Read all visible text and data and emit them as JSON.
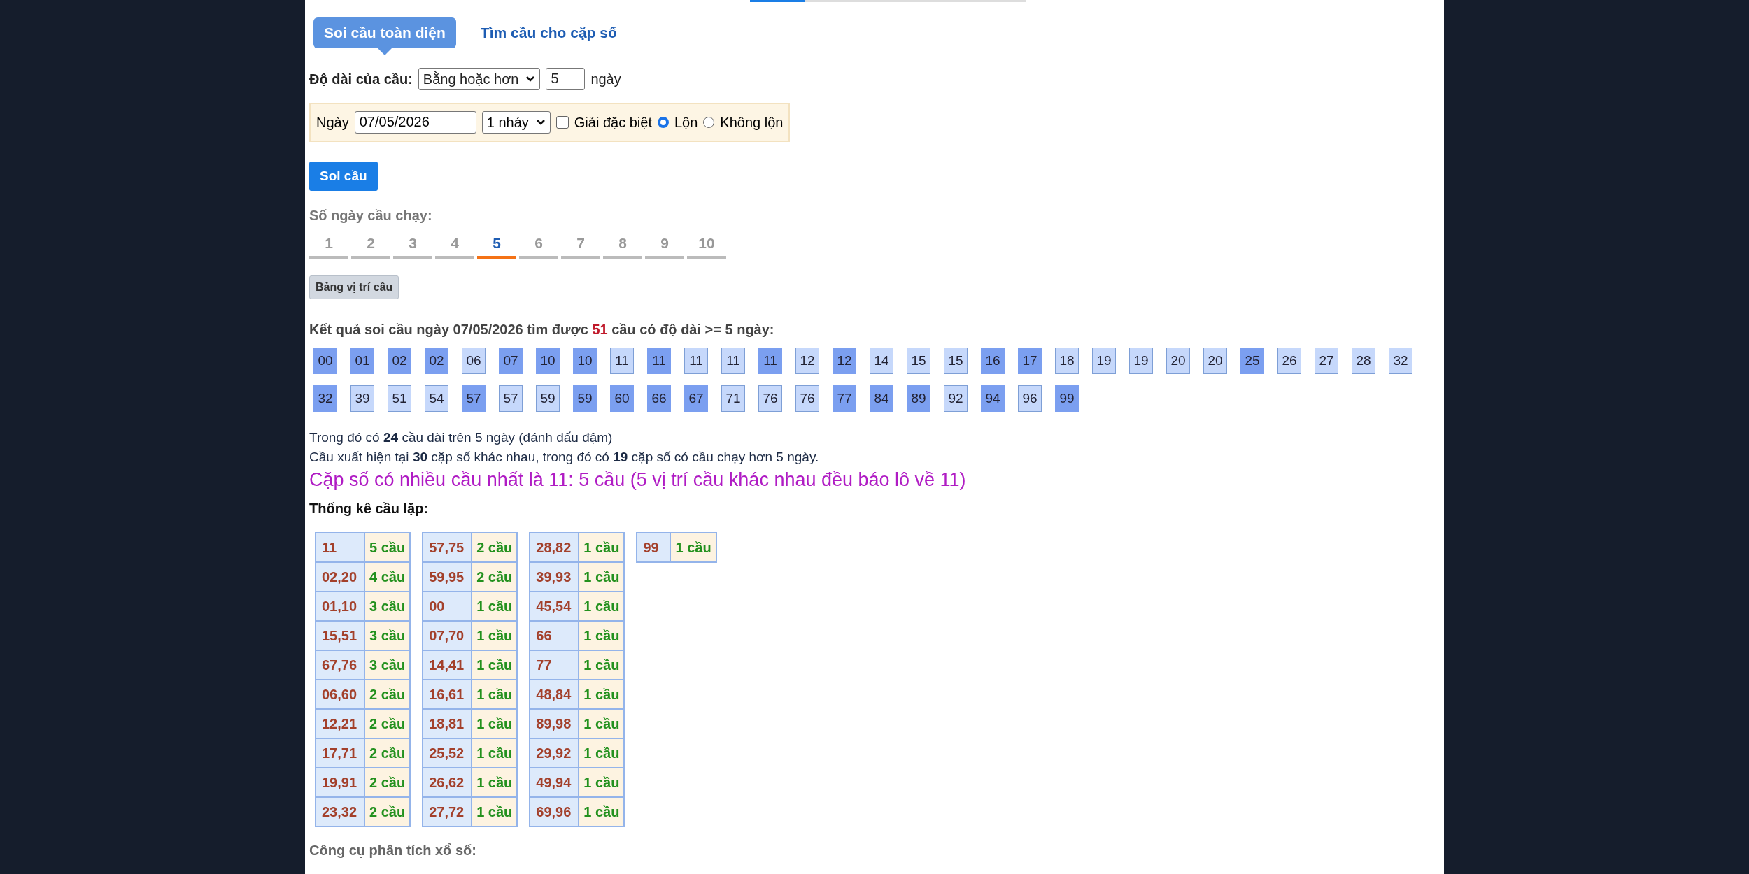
{
  "tabs": [
    {
      "label": "Soi cầu toàn diện",
      "selected": true
    },
    {
      "label": "Tìm cầu cho cặp số",
      "selected": false
    }
  ],
  "length_filter": {
    "label": "Độ dài của cầu:",
    "mode": "Bằng hoặc hơn",
    "value": "5",
    "unit": "ngày"
  },
  "options": {
    "date_label": "Ngày",
    "date": "07/05/2026",
    "jump": "1 nháy",
    "special_prize": {
      "label": "Giải đặc biệt",
      "checked": false
    },
    "modes": [
      {
        "label": "Lộn",
        "selected": true
      },
      {
        "label": "Không lộn",
        "selected": false
      }
    ]
  },
  "submit_button": "Soi cầu",
  "run_days": {
    "label": "Số ngày cầu chạy:",
    "options": [
      {
        "label": "1",
        "selected": false
      },
      {
        "label": "2",
        "selected": false
      },
      {
        "label": "3",
        "selected": false
      },
      {
        "label": "4",
        "selected": false
      },
      {
        "label": "5",
        "selected": true
      },
      {
        "label": "6",
        "selected": false
      },
      {
        "label": "7",
        "selected": false
      },
      {
        "label": "8",
        "selected": false
      },
      {
        "label": "9",
        "selected": false
      },
      {
        "label": "10",
        "selected": false
      }
    ]
  },
  "position_table_button": "Bảng vị trí cầu",
  "result_summary": "Kết quả soi cầu ngày 07/05/2026 tìm được **51** cầu có độ dài >= 5 ngày:",
  "numbers": [
    {
      "value": "00",
      "highlighted": true
    },
    {
      "value": "01",
      "highlighted": true
    },
    {
      "value": "02",
      "highlighted": true
    },
    {
      "value": "02",
      "highlighted": true
    },
    {
      "value": "06",
      "highlighted": false
    },
    {
      "value": "07",
      "highlighted": true
    },
    {
      "value": "10",
      "highlighted": true
    },
    {
      "value": "10",
      "highlighted": true
    },
    {
      "value": "11",
      "highlighted": false
    },
    {
      "value": "11",
      "highlighted": true
    },
    {
      "value": "11",
      "highlighted": false
    },
    {
      "value": "11",
      "highlighted": false
    },
    {
      "value": "11",
      "highlighted": true
    },
    {
      "value": "12",
      "highlighted": false
    },
    {
      "value": "12",
      "highlighted": true
    },
    {
      "value": "14",
      "highlighted": false
    },
    {
      "value": "15",
      "highlighted": false
    },
    {
      "value": "15",
      "highlighted": false
    },
    {
      "value": "16",
      "highlighted": true
    },
    {
      "value": "17",
      "highlighted": true
    },
    {
      "value": "18",
      "highlighted": false
    },
    {
      "value": "19",
      "highlighted": false
    },
    {
      "value": "19",
      "highlighted": false
    },
    {
      "value": "20",
      "highlighted": false
    },
    {
      "value": "20",
      "highlighted": false
    },
    {
      "value": "25",
      "highlighted": true
    },
    {
      "value": "26",
      "highlighted": false
    },
    {
      "value": "27",
      "highlighted": false
    },
    {
      "value": "28",
      "highlighted": false
    },
    {
      "value": "32",
      "highlighted": false
    },
    {
      "value": "32",
      "highlighted": true
    },
    {
      "value": "39",
      "highlighted": false
    },
    {
      "value": "51",
      "highlighted": false
    },
    {
      "value": "54",
      "highlighted": false
    },
    {
      "value": "57",
      "highlighted": true
    },
    {
      "value": "57",
      "highlighted": false
    },
    {
      "value": "59",
      "highlighted": false
    },
    {
      "value": "59",
      "highlighted": true
    },
    {
      "value": "60",
      "highlighted": true
    },
    {
      "value": "66",
      "highlighted": true
    },
    {
      "value": "67",
      "highlighted": true
    },
    {
      "value": "71",
      "highlighted": false
    },
    {
      "value": "76",
      "highlighted": false
    },
    {
      "value": "76",
      "highlighted": false
    },
    {
      "value": "77",
      "highlighted": true
    },
    {
      "value": "84",
      "highlighted": true
    },
    {
      "value": "89",
      "highlighted": true
    },
    {
      "value": "92",
      "highlighted": false
    },
    {
      "value": "94",
      "highlighted": true
    },
    {
      "value": "96",
      "highlighted": false
    },
    {
      "value": "99",
      "highlighted": true
    }
  ],
  "notes": [
    "Trong đó có **24** cầu dài trên 5 ngày (đánh dấu đậm)",
    "Cầu xuất hiện tại **30** cặp số khác nhau, trong đó có **19** cặp số có cầu chạy hơn 5 ngày."
  ],
  "top_pair": "Cặp số có nhiều cầu nhất là 11: 5 cầu (5 vị trí cầu khác nhau đều báo lô về 11)",
  "repeat_stats": {
    "title": "Thống kê cầu lặp:",
    "tables": [
      [
        {
          "pair": "11",
          "count": "5 cầu"
        },
        {
          "pair": "02,20",
          "count": "4 cầu"
        },
        {
          "pair": "01,10",
          "count": "3 cầu"
        },
        {
          "pair": "15,51",
          "count": "3 cầu"
        },
        {
          "pair": "67,76",
          "count": "3 cầu"
        },
        {
          "pair": "06,60",
          "count": "2 cầu"
        },
        {
          "pair": "12,21",
          "count": "2 cầu"
        },
        {
          "pair": "17,71",
          "count": "2 cầu"
        },
        {
          "pair": "19,91",
          "count": "2 cầu"
        },
        {
          "pair": "23,32",
          "count": "2 cầu"
        }
      ],
      [
        {
          "pair": "57,75",
          "count": "2 cầu"
        },
        {
          "pair": "59,95",
          "count": "2 cầu"
        },
        {
          "pair": "00",
          "count": "1 cầu"
        },
        {
          "pair": "07,70",
          "count": "1 cầu"
        },
        {
          "pair": "14,41",
          "count": "1 cầu"
        },
        {
          "pair": "16,61",
          "count": "1 cầu"
        },
        {
          "pair": "18,81",
          "count": "1 cầu"
        },
        {
          "pair": "25,52",
          "count": "1 cầu"
        },
        {
          "pair": "26,62",
          "count": "1 cầu"
        },
        {
          "pair": "27,72",
          "count": "1 cầu"
        }
      ],
      [
        {
          "pair": "28,82",
          "count": "1 cầu"
        },
        {
          "pair": "39,93",
          "count": "1 cầu"
        },
        {
          "pair": "45,54",
          "count": "1 cầu"
        },
        {
          "pair": "66",
          "count": "1 cầu"
        },
        {
          "pair": "77",
          "count": "1 cầu"
        },
        {
          "pair": "48,84",
          "count": "1 cầu"
        },
        {
          "pair": "89,98",
          "count": "1 cầu"
        },
        {
          "pair": "29,92",
          "count": "1 cầu"
        },
        {
          "pair": "49,94",
          "count": "1 cầu"
        },
        {
          "pair": "69,96",
          "count": "1 cầu"
        }
      ],
      [
        {
          "pair": "99",
          "count": "1 cầu"
        }
      ]
    ]
  },
  "footer_heading": "Công cụ phân tích xổ số:"
}
